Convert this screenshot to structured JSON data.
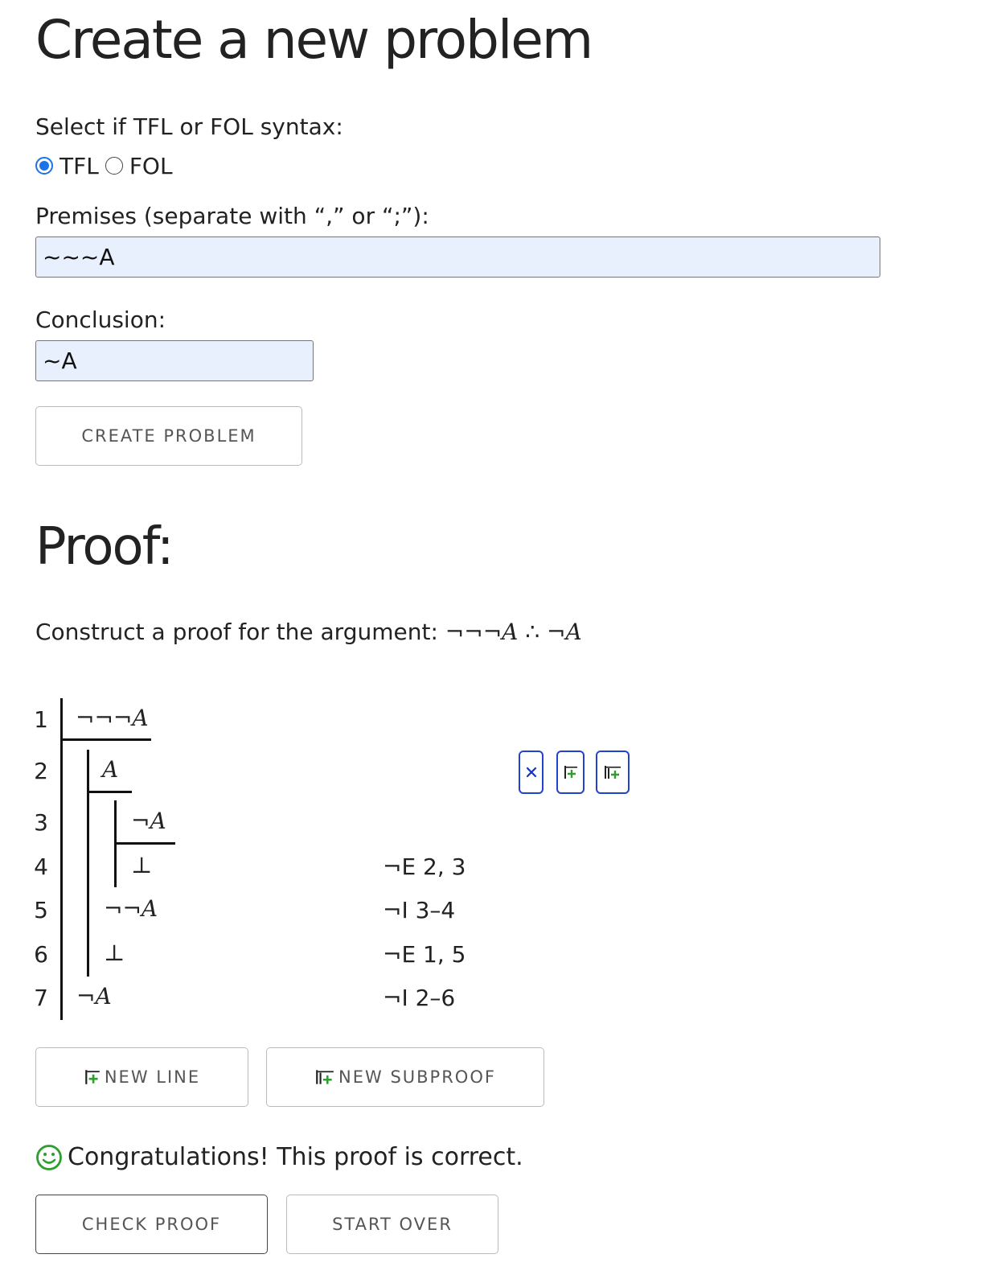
{
  "page": {
    "title": "Create a new problem"
  },
  "syntax": {
    "label": "Select if TFL or FOL syntax:",
    "options": [
      {
        "label": "TFL",
        "selected": true
      },
      {
        "label": "FOL",
        "selected": false
      }
    ]
  },
  "premises": {
    "label": "Premises (separate with “,” or “;”):",
    "value": "~~~A"
  },
  "conclusion": {
    "label": "Conclusion:",
    "value": "~A"
  },
  "create_button": {
    "label": "Create problem"
  },
  "proof": {
    "heading": "Proof:",
    "instruction_prefix": "Construct a proof for the argument: ",
    "argument_premise": "¬¬¬A",
    "therefore": "∴",
    "argument_conclusion": "¬A",
    "lines": [
      {
        "num": "1",
        "formula": "¬¬¬A",
        "justification": ""
      },
      {
        "num": "2",
        "formula": "A",
        "justification": ""
      },
      {
        "num": "3",
        "formula": "¬A",
        "justification": ""
      },
      {
        "num": "4",
        "formula": "⊥",
        "justification": "¬E 2, 3"
      },
      {
        "num": "5",
        "formula": "¬¬A",
        "justification": "¬I 3–4"
      },
      {
        "num": "6",
        "formula": "⊥",
        "justification": "¬E 1, 5"
      },
      {
        "num": "7",
        "formula": "¬A",
        "justification": "¬I 2–6"
      }
    ],
    "line_tools": [
      "delete-line-icon",
      "insert-line-icon",
      "insert-subproof-icon"
    ]
  },
  "new_line_button": {
    "label": "New line",
    "icon": "insert-line-icon"
  },
  "new_subproof_button": {
    "label": "New subproof",
    "icon": "insert-subproof-icon"
  },
  "result": {
    "icon": "smiley-icon",
    "message": "Congratulations! This proof is correct.",
    "color": "#2e9e2e"
  },
  "check_button": {
    "label": "Check proof"
  },
  "start_over_button": {
    "label": "Start over"
  },
  "colors": {
    "accent": "#1a73e8",
    "tool_border": "#2244cc",
    "input_bg": "#e8f0fe"
  }
}
